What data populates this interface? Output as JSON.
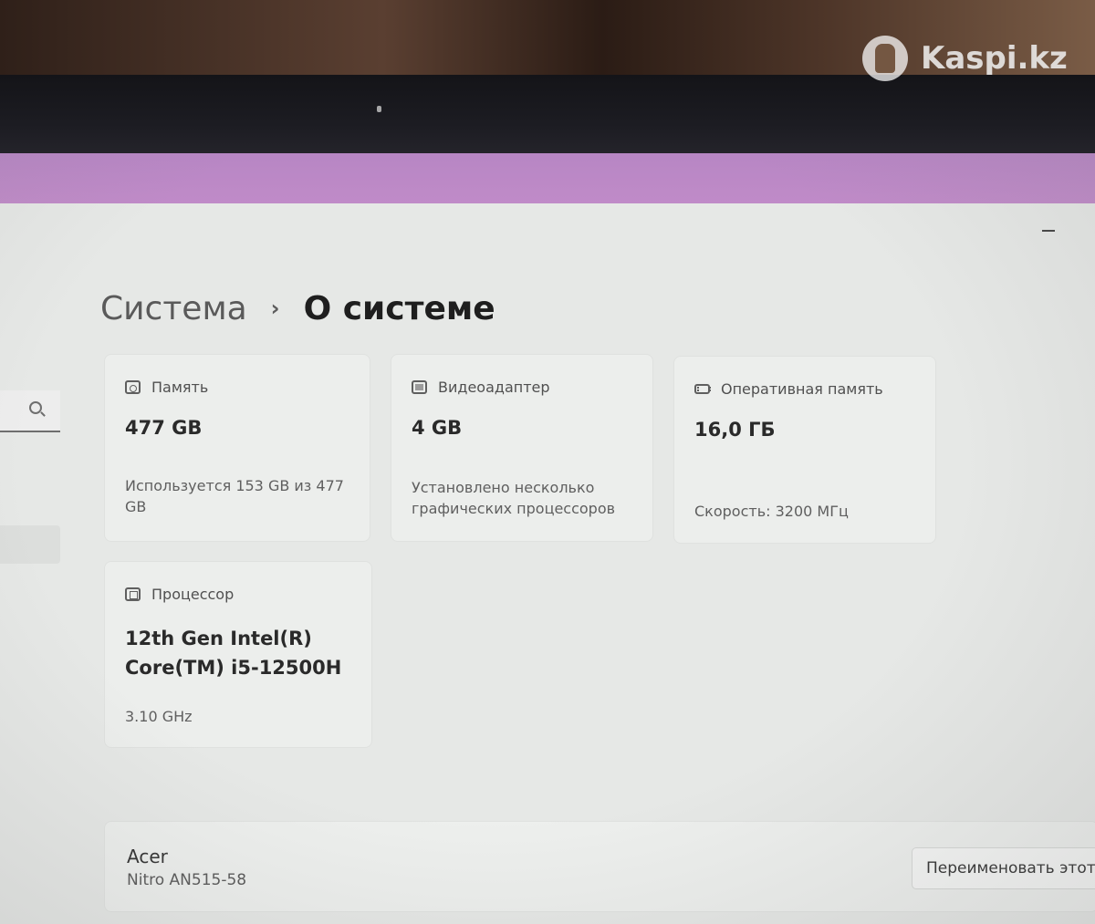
{
  "watermark": {
    "text": "Kaspi.kz",
    "icon": "kaspi-logo-icon"
  },
  "breadcrumb": {
    "parent": "Система",
    "separator": "›",
    "current": "О системе"
  },
  "specs": {
    "storage": {
      "label": "Память",
      "value": "477 GB",
      "sub": "Используется 153 GB из 477 GB",
      "icon": "storage-icon"
    },
    "gpu": {
      "label": "Видеоадаптер",
      "value": "4 GB",
      "sub": "Установлено несколько графических процессоров",
      "icon": "display-adapter-icon"
    },
    "ram": {
      "label": "Оперативная память",
      "value": "16,0 ГБ",
      "sub": "Скорость: 3200 МГц",
      "icon": "ram-icon"
    },
    "cpu": {
      "label": "Процессор",
      "value": "12th Gen Intel(R) Core(TM) i5-12500H",
      "sub": "3.10 GHz",
      "icon": "processor-icon"
    }
  },
  "device": {
    "brand": "Acer",
    "model": "Nitro AN515-58",
    "rename_label": "Переименовать этот"
  },
  "colors": {
    "title_strip": "#c08bc8",
    "window_bg": "#e6e8e6",
    "card_bg": "#eceeec"
  }
}
